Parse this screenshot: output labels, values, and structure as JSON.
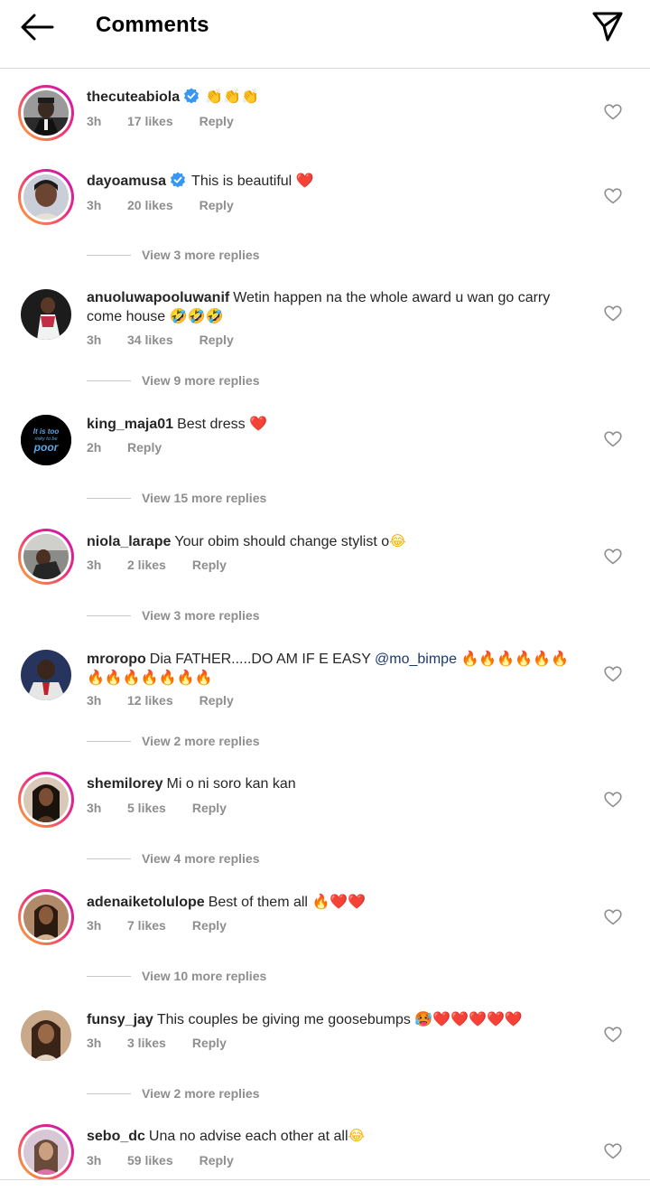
{
  "header": {
    "title": "Comments"
  },
  "comments": [
    {
      "username": "thecuteabiola",
      "verified": true,
      "text": "",
      "emoji": "👏👏👏",
      "time": "3h",
      "likes": "17 likes",
      "reply": "Reply",
      "view_more": ""
    },
    {
      "username": "dayoamusa",
      "verified": true,
      "text": "This is beautiful",
      "emoji": "❤️",
      "time": "3h",
      "likes": "20 likes",
      "reply": "Reply",
      "view_more": "View 3 more replies"
    },
    {
      "username": "anuoluwapooluwanif",
      "verified": false,
      "text": "Wetin happen na the whole award u wan go carry come house",
      "emoji": "🤣🤣🤣",
      "time": "3h",
      "likes": "34 likes",
      "reply": "Reply",
      "view_more": "View 9 more replies"
    },
    {
      "username": "king_maja01",
      "verified": false,
      "text": "Best dress",
      "emoji": "❤️",
      "time": "2h",
      "likes": "",
      "reply": "Reply",
      "view_more": "View 15 more replies"
    },
    {
      "username": "niola_larape",
      "verified": false,
      "text": "Your obim should change stylist o",
      "emoji": "😂",
      "time": "3h",
      "likes": "2 likes",
      "reply": "Reply",
      "view_more": "View 3 more replies"
    },
    {
      "username": "mroropo",
      "verified": false,
      "text": "Dia FATHER.....DO AM IF E EASY",
      "mention": "@mo_bimpe",
      "emoji": "🔥🔥🔥🔥🔥🔥🔥🔥🔥🔥🔥🔥🔥",
      "time": "3h",
      "likes": "12 likes",
      "reply": "Reply",
      "view_more": "View 2 more replies"
    },
    {
      "username": "shemilorey",
      "verified": false,
      "text": "Mi o ni soro kan kan",
      "emoji": "",
      "time": "3h",
      "likes": "5 likes",
      "reply": "Reply",
      "view_more": "View 4 more replies"
    },
    {
      "username": "adenaiketolulope",
      "verified": false,
      "text": "Best of them all",
      "emoji": "🔥❤️❤️",
      "time": "3h",
      "likes": "7 likes",
      "reply": "Reply",
      "view_more": "View 10 more replies"
    },
    {
      "username": "funsy_jay",
      "verified": false,
      "text": "This couples be giving me goosebumps",
      "emoji": "🥵❤️❤️❤️❤️❤️",
      "time": "3h",
      "likes": "3 likes",
      "reply": "Reply",
      "view_more": "View 2 more replies"
    },
    {
      "username": "sebo_dc",
      "verified": false,
      "text": "Una no advise each other at all",
      "emoji": "😂",
      "time": "3h",
      "likes": "59 likes",
      "reply": "Reply",
      "view_more": ""
    }
  ],
  "avatars": {
    "king_maja01": {
      "line1": "It is too",
      "line2": "risky to be",
      "line3": "poor"
    }
  },
  "colors": {
    "verified": "#3897f0",
    "ring_start": "#f9b233",
    "ring_end": "#c913b9",
    "meta_gray": "#8e8e8e"
  }
}
